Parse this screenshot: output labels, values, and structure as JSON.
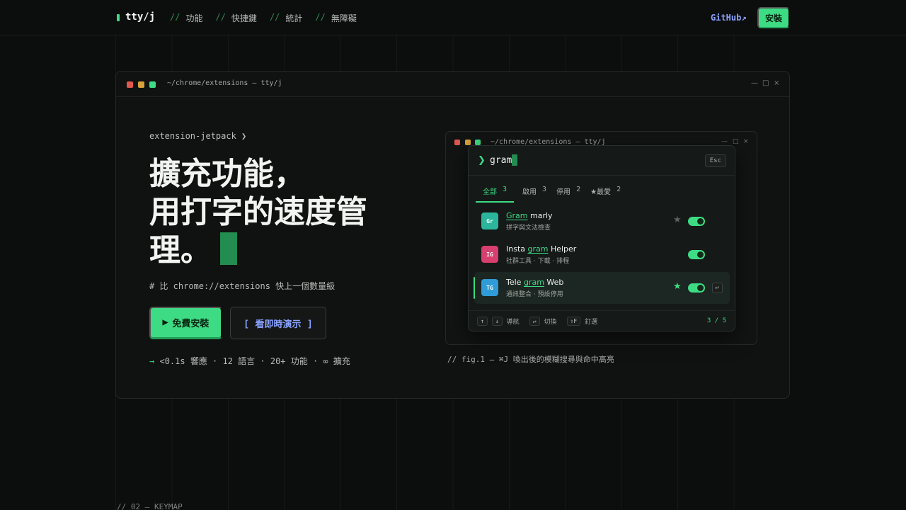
{
  "nav": {
    "brand": "tty/j",
    "links": [
      {
        "prefix": "//",
        "label": "功能"
      },
      {
        "prefix": "//",
        "label": "快捷鍵"
      },
      {
        "prefix": "//",
        "label": "統計"
      },
      {
        "prefix": "//",
        "label": "無障礙"
      }
    ],
    "github": "GitHub↗",
    "install": "安裝"
  },
  "window": {
    "title": "~/chrome/extensions — tty/j",
    "controls": [
      "—",
      "□",
      "×"
    ]
  },
  "hero": {
    "eyebrow": "extension-jetpack ❯",
    "title_line1": "擴充功能，",
    "title_line2": "用打字的速度管",
    "title_line3": "理。",
    "subtitle": "# 比 chrome://extensions 快上一個數量級",
    "cta_primary_icon": "▶",
    "cta_primary": "免費安裝",
    "cta_secondary_open": "[",
    "cta_secondary": "看即時演示",
    "cta_secondary_close": "]",
    "stats_arrow": "→",
    "stats": "<0.1s 響應 · 12 語言 · 20+ 功能 · ∞ 擴充"
  },
  "demo": {
    "window_title": "~/chrome/extensions — tty/j",
    "controls": [
      "—",
      "□",
      "×"
    ],
    "palette": {
      "prompt": "❯",
      "query": "gram",
      "esc": "Esc",
      "tabs": [
        {
          "label": "全部",
          "count": "3"
        },
        {
          "label": "啟用",
          "count": "3"
        },
        {
          "label": "停用",
          "count": "2"
        },
        {
          "label": "★最愛",
          "count": "2"
        }
      ],
      "rows": [
        {
          "badge": "Gr",
          "badge_color": "#2bb59a",
          "pre": "",
          "match": "Gram",
          "post": " marly",
          "desc": "拼字與文法檢查",
          "star": "★",
          "star_color": "#5c625e",
          "enabled": true
        },
        {
          "badge": "IG",
          "badge_color": "#d63f6e",
          "pre": "Insta ",
          "match": "gram",
          "post": " Helper",
          "desc": "社群工具 · 下載 · 排程",
          "star": "",
          "star_color": "#5c625e",
          "enabled": true
        },
        {
          "badge": "TG",
          "badge_color": "#2f9bd8",
          "pre": "Tele ",
          "match": "gram",
          "post": " Web",
          "desc": "通訊整合 · 預設停用",
          "star": "★",
          "star_color": "#3ddc84",
          "enabled": true,
          "enter": "↵"
        }
      ],
      "footer": {
        "key_up": "↑",
        "key_down": "↓",
        "nav_label": "導航",
        "key_enter": "↵",
        "toggle_label": "切換",
        "key_pin": "⇧F",
        "pin_label": "釘選",
        "count": "3 / 5"
      }
    },
    "caption": "// fig.1 — ⌘J 喚出後的模糊搜尋與命中高亮"
  },
  "next_section": "// 02 — KEYMAP",
  "colors": {
    "accent": "#3ddc84",
    "link": "#8aa3ff",
    "background": "#0c0d0d"
  }
}
